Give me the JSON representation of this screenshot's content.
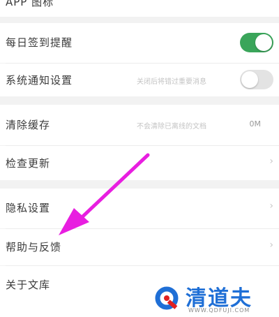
{
  "colors": {
    "accent_green": "#3aa55a",
    "toggle_off": "#e3e3e3",
    "arrow": "#e81ee0",
    "watermark_blue": "#1f6fd6",
    "watermark_red": "#e02020"
  },
  "partial_top": {
    "label": "APP 图标"
  },
  "rows": [
    {
      "label": "每日签到提醒",
      "toggle": "on"
    },
    {
      "label": "系统通知设置",
      "hint": "关闭后将错过重要消息",
      "toggle": "off"
    },
    {
      "label": "清除缓存",
      "hint": "不会清除已离线的文档",
      "value": "0M"
    },
    {
      "label": "检查更新",
      "icon": "chevron-right-icon"
    },
    {
      "label": "隐私设置",
      "icon": "chevron-right-icon"
    },
    {
      "label": "帮助与反馈",
      "icon": "chevron-right-icon"
    },
    {
      "label": "关于文库"
    }
  ],
  "watermark": {
    "brand": "清道夫",
    "url": "WWW.QDFUJI.COM"
  }
}
